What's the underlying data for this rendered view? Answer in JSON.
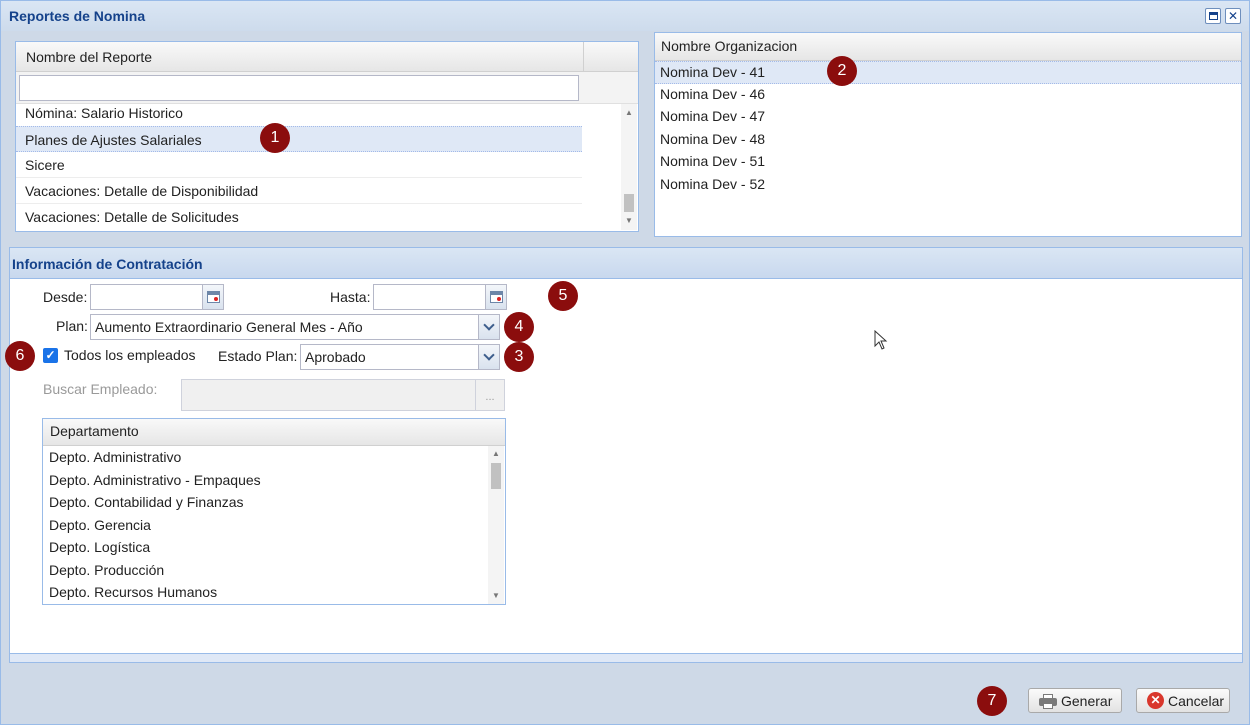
{
  "window": {
    "title": "Reportes de Nomina"
  },
  "reports_grid": {
    "header": "Nombre del Reporte",
    "filter_value": "",
    "rows": [
      "Nómina: Salario Historico",
      "Planes de Ajustes Salariales",
      "Sicere",
      "Vacaciones: Detalle de Disponibilidad",
      "Vacaciones: Detalle de Solicitudes"
    ],
    "selected": "Planes de Ajustes Salariales"
  },
  "org_grid": {
    "header": "Nombre Organizacion",
    "rows": [
      "Nomina Dev - 41",
      "Nomina Dev - 46",
      "Nomina Dev - 47",
      "Nomina Dev - 48",
      "Nomina Dev - 51",
      "Nomina Dev - 52"
    ],
    "selected": "Nomina Dev - 41"
  },
  "contract_info": {
    "title": "Información de Contratación",
    "desde_label": "Desde:",
    "desde_value": "",
    "hasta_label": "Hasta:",
    "hasta_value": "",
    "plan_label": "Plan:",
    "plan_value": "Aumento Extraordinario General Mes - Año",
    "todos_label": "Todos los empleados",
    "todos_checked": true,
    "estado_label": "Estado Plan:",
    "estado_value": "Aprobado",
    "buscar_label": "Buscar Empleado:",
    "buscar_value": "",
    "buscar_button": "..."
  },
  "dept_grid": {
    "header": "Departamento",
    "rows": [
      "Depto. Administrativo",
      "Depto. Administrativo - Empaques",
      "Depto. Contabilidad y Finanzas",
      "Depto. Gerencia",
      "Depto. Logística",
      "Depto. Producción",
      "Depto. Recursos Humanos"
    ]
  },
  "footer": {
    "generate_label": "Generar",
    "cancel_label": "Cancelar"
  },
  "markers": [
    "1",
    "2",
    "3",
    "4",
    "5",
    "6",
    "7"
  ],
  "icons": {
    "restore": "maximize-icon",
    "close": "close-icon",
    "calendar": "calendar-icon",
    "dropdown": "chevron-down-icon",
    "printer": "printer-icon",
    "cancel": "cancel-icon",
    "checkbox": "checkmark-icon"
  },
  "colors": {
    "title_text": "#15428b",
    "marker": "#8b0d0d",
    "selection": "#dfe8f6",
    "checkbox": "#1a73e8"
  }
}
